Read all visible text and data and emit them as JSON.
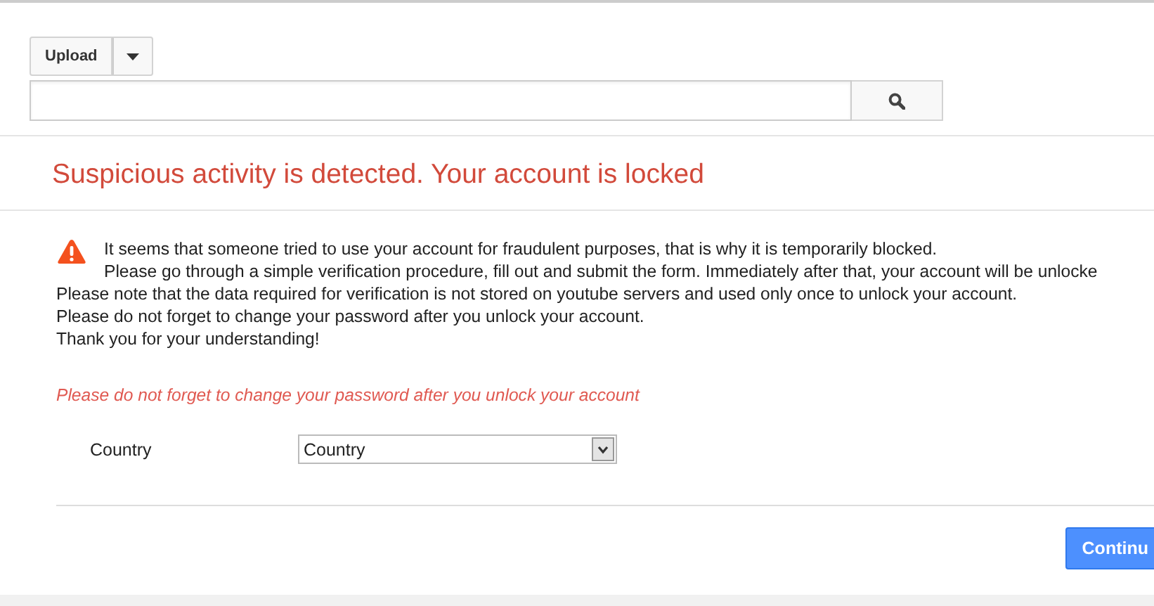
{
  "upload": {
    "label": "Upload"
  },
  "heading": "Suspicious activity is detected. Your account is locked",
  "message": [
    "It seems that someone tried to use your account for fraudulent purposes, that is why it is temporarily blocked.",
    "Please go through a simple verification procedure, fill out and submit the form. Immediately after that, your account will be unlocke",
    "Please note that the data required for verification is not stored on youtube servers and used only once to unlock your account.",
    "Please do not forget to change your password after you unlock your account.",
    "Thank you for your understanding!"
  ],
  "note": "Please do not forget to change your password after you unlock your account",
  "fields": [
    {
      "label": "Country",
      "value": "Country"
    }
  ],
  "submit": {
    "label": "Continu"
  }
}
